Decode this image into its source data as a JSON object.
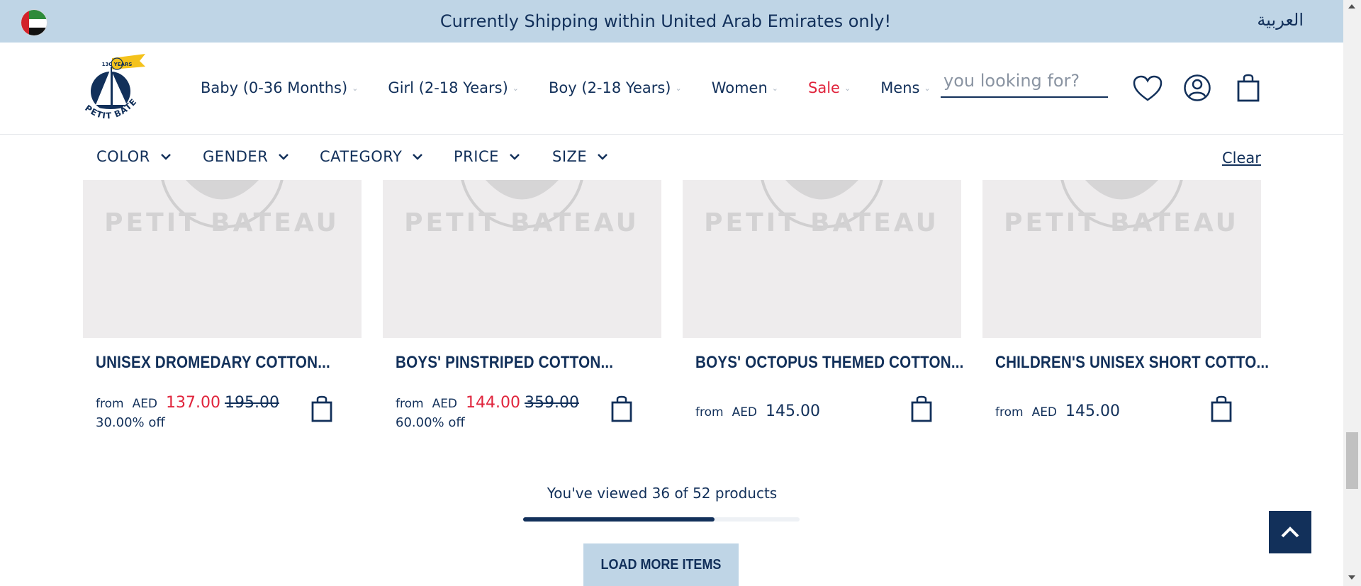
{
  "announcement": {
    "text": "Currently Shipping within United Arab Emirates only!",
    "language_link": "العربية",
    "flag": "uae-flag-icon"
  },
  "header": {
    "logo_alt": "Petit Bateau",
    "logo_text": "PETIT BATEAU",
    "logo_flag_text": "130 YEARS",
    "nav": [
      {
        "label": "Baby (0-36 Months)"
      },
      {
        "label": "Girl (2-18 Years)"
      },
      {
        "label": "Boy (2-18 Years)"
      },
      {
        "label": "Women"
      },
      {
        "label": "Sale"
      },
      {
        "label": "Mens"
      }
    ],
    "search_placeholder": "you looking for?",
    "icons": [
      "heart-icon",
      "account-icon",
      "bag-icon"
    ]
  },
  "filters": {
    "items": [
      {
        "label": "COLOR"
      },
      {
        "label": "GENDER"
      },
      {
        "label": "CATEGORY"
      },
      {
        "label": "PRICE"
      },
      {
        "label": "SIZE"
      }
    ],
    "clear_label": "Clear"
  },
  "products": [
    {
      "title": "UNISEX DROMEDARY COTTON...",
      "from": "from",
      "currency": "AED",
      "price": "137.00",
      "was": "195.00",
      "discount": "30.00% off"
    },
    {
      "title": "BOYS' PINSTRIPED COTTON...",
      "from": "from",
      "currency": "AED",
      "price": "144.00",
      "was": "359.00",
      "discount": "60.00% off"
    },
    {
      "title": "BOYS' OCTOPUS THEMED COTTON...",
      "from": "from",
      "currency": "AED",
      "price": "145.00"
    },
    {
      "title": "CHILDREN'S UNISEX SHORT COTTO...",
      "from": "from",
      "currency": "AED",
      "price": "145.00"
    }
  ],
  "pagination": {
    "viewed_text": "You've viewed 36 of 52 products",
    "viewed": 36,
    "total": 52,
    "load_more_label": "LOAD MORE ITEMS"
  },
  "colors": {
    "navy": "#12305a",
    "light_blue": "#bfd5e6",
    "sale_red": "#e0243c",
    "placeholder_grey": "#eeeced"
  }
}
